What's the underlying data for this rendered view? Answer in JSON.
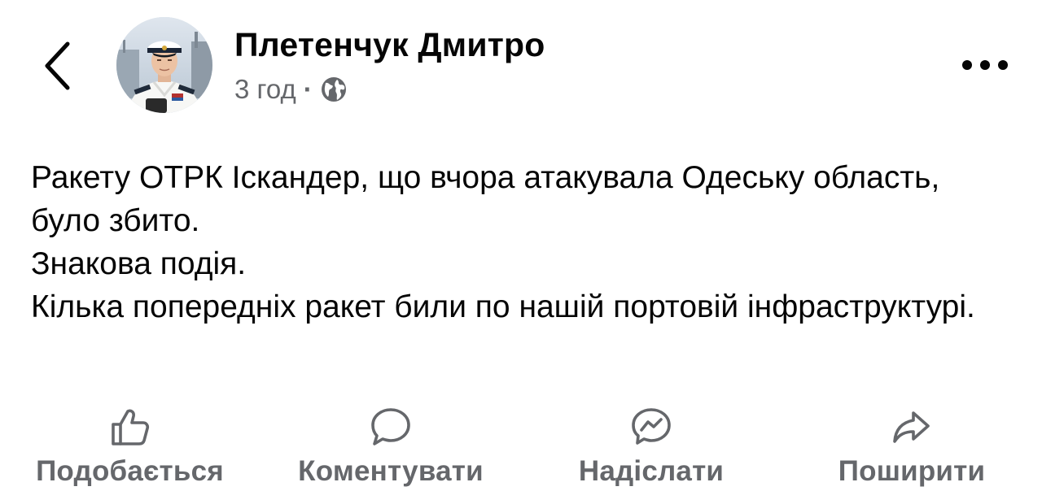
{
  "header": {
    "author_name": "Плетенчук Дмитро",
    "time": "3 год",
    "separator": "·",
    "audience_icon": "globe-icon",
    "back_icon": "chevron-left-icon",
    "more_icon": "more-horizontal-icon"
  },
  "post": {
    "lines": [
      "Ракету ОТРК Іскандер, що вчора атакувала Одеську область, було збито.",
      "Знакова подія.",
      "Кілька попередніх ракет били по нашій портовій інфраструктурі."
    ]
  },
  "actions": {
    "like": {
      "label": "Подобається",
      "icon": "thumbs-up-icon"
    },
    "comment": {
      "label": "Коментувати",
      "icon": "comment-icon"
    },
    "send": {
      "label": "Надіслати",
      "icon": "messenger-icon"
    },
    "share": {
      "label": "Поширити",
      "icon": "share-icon"
    }
  },
  "colors": {
    "text_primary": "#050505",
    "text_secondary": "#65676b",
    "background": "#ffffff"
  }
}
